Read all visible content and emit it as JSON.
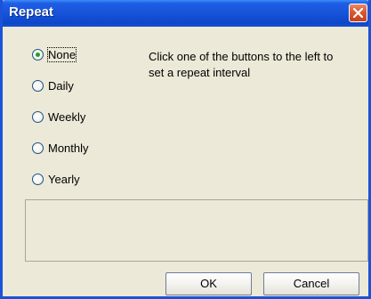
{
  "window": {
    "title": "Repeat"
  },
  "options": [
    {
      "label": "None",
      "checked": true
    },
    {
      "label": "Daily",
      "checked": false
    },
    {
      "label": "Weekly",
      "checked": false
    },
    {
      "label": "Monthly",
      "checked": false
    },
    {
      "label": "Yearly",
      "checked": false
    }
  ],
  "hint": "Click one of the buttons to the left to set a repeat interval",
  "buttons": {
    "ok_label": "OK",
    "cancel_label": "Cancel"
  },
  "icons": {
    "close": "close-icon",
    "radio": "radio-icon"
  },
  "colors": {
    "titlebar": "#1552d8",
    "window_bg": "#ece9d8",
    "close_button": "#d75932",
    "radio_dot": "#21a121"
  }
}
